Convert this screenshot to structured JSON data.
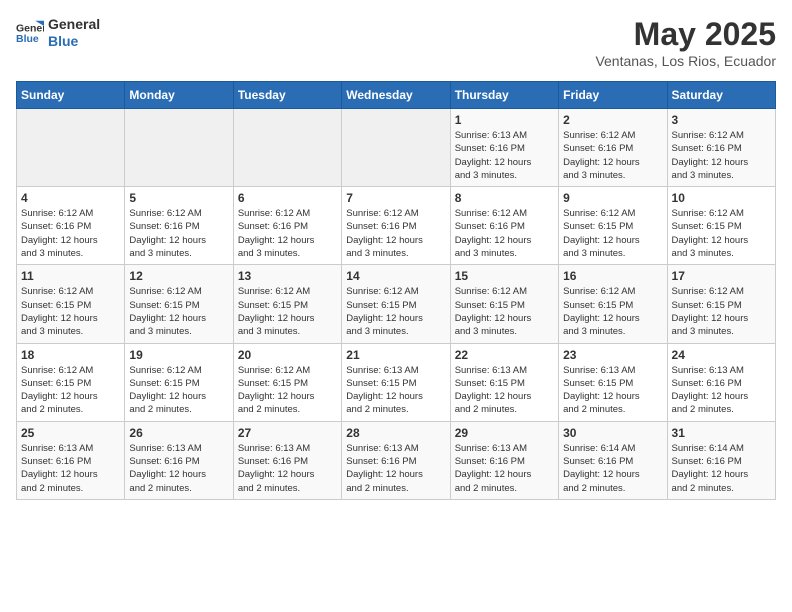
{
  "logo": {
    "line1": "General",
    "line2": "Blue"
  },
  "title": "May 2025",
  "location": "Ventanas, Los Rios, Ecuador",
  "days_header": [
    "Sunday",
    "Monday",
    "Tuesday",
    "Wednesday",
    "Thursday",
    "Friday",
    "Saturday"
  ],
  "weeks": [
    [
      {
        "day": "",
        "info": ""
      },
      {
        "day": "",
        "info": ""
      },
      {
        "day": "",
        "info": ""
      },
      {
        "day": "",
        "info": ""
      },
      {
        "day": "1",
        "info": "Sunrise: 6:13 AM\nSunset: 6:16 PM\nDaylight: 12 hours\nand 3 minutes."
      },
      {
        "day": "2",
        "info": "Sunrise: 6:12 AM\nSunset: 6:16 PM\nDaylight: 12 hours\nand 3 minutes."
      },
      {
        "day": "3",
        "info": "Sunrise: 6:12 AM\nSunset: 6:16 PM\nDaylight: 12 hours\nand 3 minutes."
      }
    ],
    [
      {
        "day": "4",
        "info": "Sunrise: 6:12 AM\nSunset: 6:16 PM\nDaylight: 12 hours\nand 3 minutes."
      },
      {
        "day": "5",
        "info": "Sunrise: 6:12 AM\nSunset: 6:16 PM\nDaylight: 12 hours\nand 3 minutes."
      },
      {
        "day": "6",
        "info": "Sunrise: 6:12 AM\nSunset: 6:16 PM\nDaylight: 12 hours\nand 3 minutes."
      },
      {
        "day": "7",
        "info": "Sunrise: 6:12 AM\nSunset: 6:16 PM\nDaylight: 12 hours\nand 3 minutes."
      },
      {
        "day": "8",
        "info": "Sunrise: 6:12 AM\nSunset: 6:16 PM\nDaylight: 12 hours\nand 3 minutes."
      },
      {
        "day": "9",
        "info": "Sunrise: 6:12 AM\nSunset: 6:15 PM\nDaylight: 12 hours\nand 3 minutes."
      },
      {
        "day": "10",
        "info": "Sunrise: 6:12 AM\nSunset: 6:15 PM\nDaylight: 12 hours\nand 3 minutes."
      }
    ],
    [
      {
        "day": "11",
        "info": "Sunrise: 6:12 AM\nSunset: 6:15 PM\nDaylight: 12 hours\nand 3 minutes."
      },
      {
        "day": "12",
        "info": "Sunrise: 6:12 AM\nSunset: 6:15 PM\nDaylight: 12 hours\nand 3 minutes."
      },
      {
        "day": "13",
        "info": "Sunrise: 6:12 AM\nSunset: 6:15 PM\nDaylight: 12 hours\nand 3 minutes."
      },
      {
        "day": "14",
        "info": "Sunrise: 6:12 AM\nSunset: 6:15 PM\nDaylight: 12 hours\nand 3 minutes."
      },
      {
        "day": "15",
        "info": "Sunrise: 6:12 AM\nSunset: 6:15 PM\nDaylight: 12 hours\nand 3 minutes."
      },
      {
        "day": "16",
        "info": "Sunrise: 6:12 AM\nSunset: 6:15 PM\nDaylight: 12 hours\nand 3 minutes."
      },
      {
        "day": "17",
        "info": "Sunrise: 6:12 AM\nSunset: 6:15 PM\nDaylight: 12 hours\nand 3 minutes."
      }
    ],
    [
      {
        "day": "18",
        "info": "Sunrise: 6:12 AM\nSunset: 6:15 PM\nDaylight: 12 hours\nand 2 minutes."
      },
      {
        "day": "19",
        "info": "Sunrise: 6:12 AM\nSunset: 6:15 PM\nDaylight: 12 hours\nand 2 minutes."
      },
      {
        "day": "20",
        "info": "Sunrise: 6:12 AM\nSunset: 6:15 PM\nDaylight: 12 hours\nand 2 minutes."
      },
      {
        "day": "21",
        "info": "Sunrise: 6:13 AM\nSunset: 6:15 PM\nDaylight: 12 hours\nand 2 minutes."
      },
      {
        "day": "22",
        "info": "Sunrise: 6:13 AM\nSunset: 6:15 PM\nDaylight: 12 hours\nand 2 minutes."
      },
      {
        "day": "23",
        "info": "Sunrise: 6:13 AM\nSunset: 6:15 PM\nDaylight: 12 hours\nand 2 minutes."
      },
      {
        "day": "24",
        "info": "Sunrise: 6:13 AM\nSunset: 6:16 PM\nDaylight: 12 hours\nand 2 minutes."
      }
    ],
    [
      {
        "day": "25",
        "info": "Sunrise: 6:13 AM\nSunset: 6:16 PM\nDaylight: 12 hours\nand 2 minutes."
      },
      {
        "day": "26",
        "info": "Sunrise: 6:13 AM\nSunset: 6:16 PM\nDaylight: 12 hours\nand 2 minutes."
      },
      {
        "day": "27",
        "info": "Sunrise: 6:13 AM\nSunset: 6:16 PM\nDaylight: 12 hours\nand 2 minutes."
      },
      {
        "day": "28",
        "info": "Sunrise: 6:13 AM\nSunset: 6:16 PM\nDaylight: 12 hours\nand 2 minutes."
      },
      {
        "day": "29",
        "info": "Sunrise: 6:13 AM\nSunset: 6:16 PM\nDaylight: 12 hours\nand 2 minutes."
      },
      {
        "day": "30",
        "info": "Sunrise: 6:14 AM\nSunset: 6:16 PM\nDaylight: 12 hours\nand 2 minutes."
      },
      {
        "day": "31",
        "info": "Sunrise: 6:14 AM\nSunset: 6:16 PM\nDaylight: 12 hours\nand 2 minutes."
      }
    ]
  ]
}
